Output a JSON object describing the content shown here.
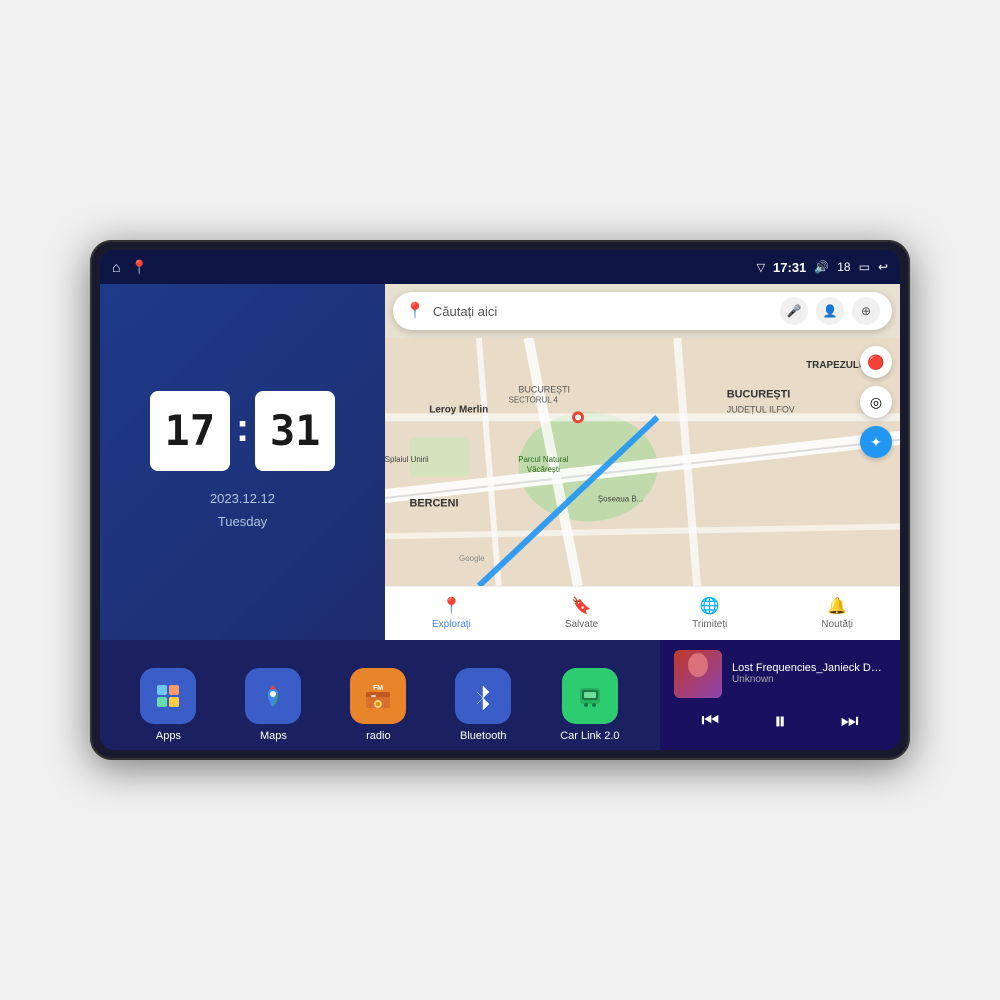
{
  "device": {
    "status_bar": {
      "left_icons": [
        "home",
        "location"
      ],
      "time": "17:31",
      "signal_icon": "▽",
      "volume_icon": "🔊",
      "volume_level": "18",
      "battery_icon": "▭",
      "back_icon": "↩"
    },
    "clock": {
      "hour": "17",
      "minute": "31",
      "date": "2023.12.12",
      "day": "Tuesday"
    },
    "map": {
      "search_placeholder": "Căutați aici",
      "location": "București",
      "district": "JUDEȚUL ILFOV",
      "label_berceni": "BERCENI",
      "label_trapezului": "TRAPEZULUI",
      "nav_items": [
        {
          "label": "Explorați",
          "icon": "📍",
          "active": true
        },
        {
          "label": "Salvate",
          "icon": "🔖",
          "active": false
        },
        {
          "label": "Trimiteți",
          "icon": "🌐",
          "active": false
        },
        {
          "label": "Noutăți",
          "icon": "🔔",
          "active": false
        }
      ]
    },
    "apps": [
      {
        "id": "apps",
        "label": "Apps",
        "icon": "⊞",
        "color": "#3a5dc8"
      },
      {
        "id": "maps",
        "label": "Maps",
        "icon": "🗺",
        "color": "#3a5dc8"
      },
      {
        "id": "radio",
        "label": "radio",
        "icon": "📻",
        "color": "#e8842a"
      },
      {
        "id": "bluetooth",
        "label": "Bluetooth",
        "icon": "⑁",
        "color": "#3a5dc8"
      },
      {
        "id": "carlink",
        "label": "Car Link 2.0",
        "icon": "📱",
        "color": "#2ecc71"
      }
    ],
    "music": {
      "title": "Lost Frequencies_Janieck Devy-...",
      "artist": "Unknown",
      "prev_label": "⏮",
      "play_label": "⏸",
      "next_label": "⏭"
    }
  }
}
